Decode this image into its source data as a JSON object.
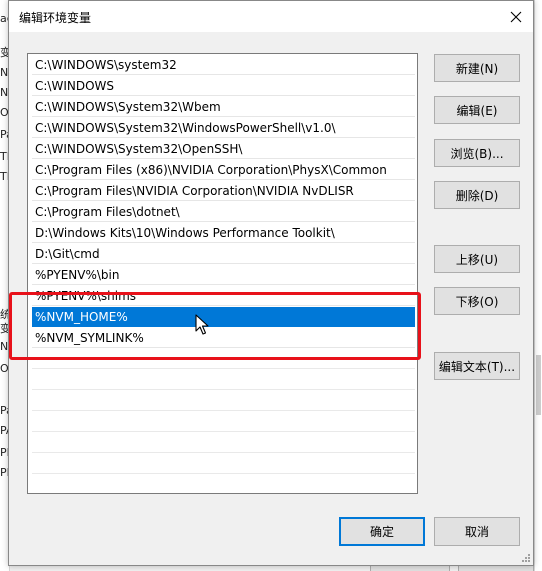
{
  "background": {
    "left_chars": [
      "ac",
      "变",
      "N",
      "N",
      "O",
      "Pa",
      "TE",
      "TM",
      "统",
      "变",
      "N",
      "O",
      "Pa",
      "PA",
      "PF",
      "PF"
    ]
  },
  "dialog": {
    "title": "编辑环境变量",
    "close_icon": "close-icon"
  },
  "path_list": [
    "C:\\WINDOWS\\system32",
    "C:\\WINDOWS",
    "C:\\WINDOWS\\System32\\Wbem",
    "C:\\WINDOWS\\System32\\WindowsPowerShell\\v1.0\\",
    "C:\\WINDOWS\\System32\\OpenSSH\\",
    "C:\\Program Files (x86)\\NVIDIA Corporation\\PhysX\\Common",
    "C:\\Program Files\\NVIDIA Corporation\\NVIDIA NvDLISR",
    "C:\\Program Files\\dotnet\\",
    "D:\\Windows Kits\\10\\Windows Performance Toolkit\\",
    "D:\\Git\\cmd",
    "%PYENV%\\bin",
    "%PYENV%\\shims",
    "%NVM_HOME%",
    "%NVM_SYMLINK%"
  ],
  "selected_entry": "%NVM_HOME%",
  "buttons": {
    "new": "新建(N)",
    "edit": "编辑(E)",
    "browse": "浏览(B)...",
    "delete": "删除(D)",
    "move_up": "上移(U)",
    "move_down": "下移(O)",
    "edit_text": "编辑文本(T)...",
    "ok": "确定",
    "cancel": "取消"
  },
  "colors": {
    "selection": "#0078d7",
    "highlight_box": "#e8111a"
  }
}
